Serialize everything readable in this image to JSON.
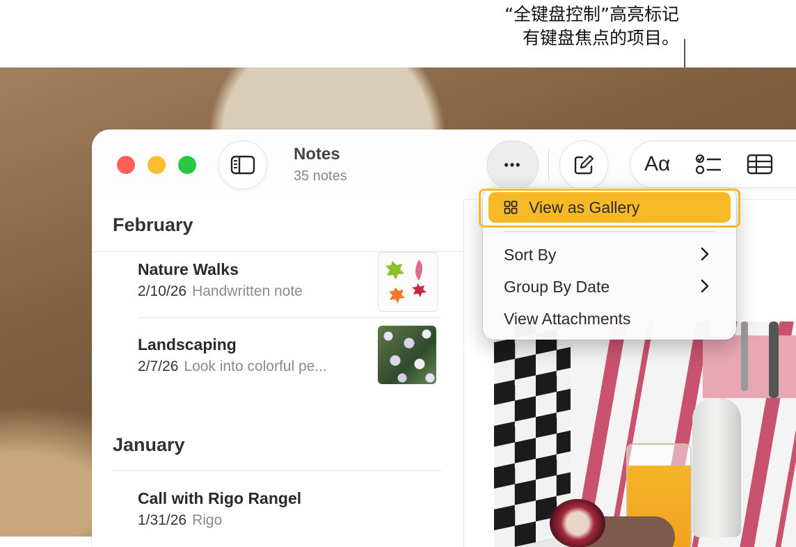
{
  "annotation": {
    "line1": "“全键盘控制”高亮标记",
    "line2": "有键盘焦点的项目。"
  },
  "window": {
    "title": "Notes",
    "subtitle": "35 notes",
    "toolbar": {
      "more_label": "•••",
      "format_label": "Aα"
    }
  },
  "sidebar": {
    "sections": [
      {
        "label": "February",
        "notes": [
          {
            "title": "Nature Walks",
            "date": "2/10/26",
            "preview": "Handwritten note",
            "thumbnail": "leaves-sketch"
          },
          {
            "title": "Landscaping",
            "date": "2/7/26",
            "preview": "Look into colorful pe...",
            "thumbnail": "flowers-photo"
          }
        ]
      },
      {
        "label": "January",
        "notes": [
          {
            "title": "Call with Rigo Rangel",
            "date": "1/31/26",
            "preview": "Rigo"
          }
        ]
      }
    ]
  },
  "menu": {
    "items": [
      {
        "label": "View as Gallery",
        "icon": "grid-icon",
        "focused": true
      },
      {
        "label": "Sort By",
        "submenu": true
      },
      {
        "label": "Group By Date",
        "submenu": true
      },
      {
        "label": "View Attachments"
      }
    ]
  },
  "colors": {
    "focus": "#f7b925",
    "close": "#ff5f57",
    "minimize": "#febc2e",
    "zoom": "#28c840"
  }
}
